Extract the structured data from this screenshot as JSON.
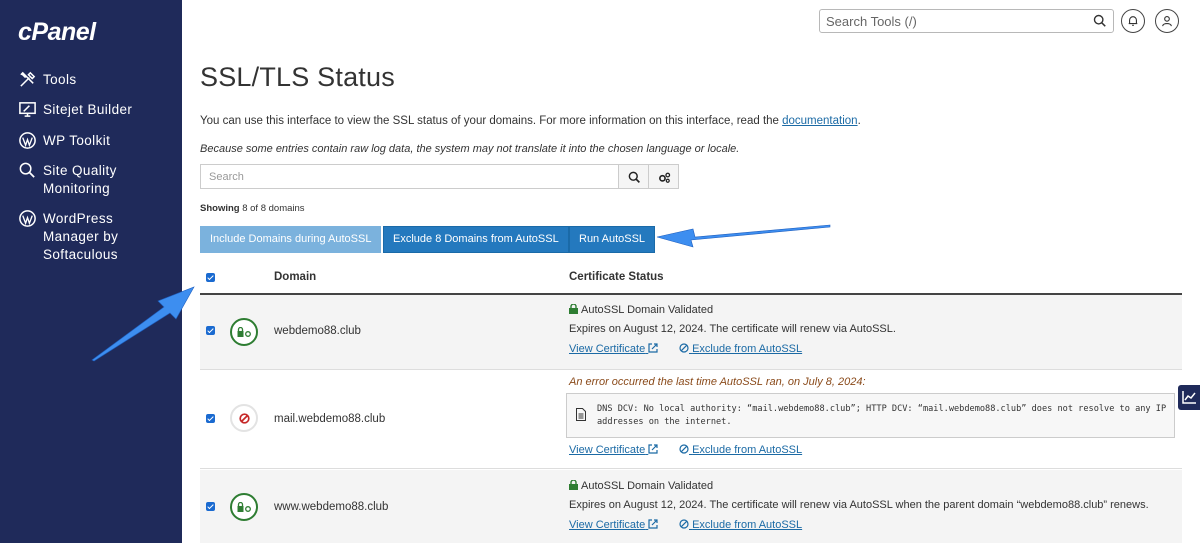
{
  "app": {
    "logo": "cPanel"
  },
  "sidebar": {
    "items": [
      {
        "label": "Tools",
        "icon": "tools-icon"
      },
      {
        "label": "Sitejet Builder",
        "icon": "monitor-icon"
      },
      {
        "label": "WP Toolkit",
        "icon": "wordpress-icon"
      },
      {
        "label": "Site Quality Monitoring",
        "icon": "magnifier-icon"
      },
      {
        "label": "WordPress Manager by Softaculous",
        "icon": "wordpress-icon"
      }
    ]
  },
  "topbar": {
    "search_placeholder": "Search Tools (/)"
  },
  "page": {
    "title": "SSL/TLS Status",
    "intro_text": "You can use this interface to view the SSL status of your domains. For more information on this interface, read the ",
    "intro_link": "documentation",
    "intro_end": ".",
    "note": "Because some entries contain raw log data, the system may not translate it into the chosen language or locale.",
    "filter_placeholder": "Search",
    "showing_label": "Showing",
    "showing_text": "8 of 8 domains"
  },
  "actions": {
    "include": "Include Domains during AutoSSL",
    "exclude": "Exclude 8 Domains from AutoSSL",
    "run": "Run AutoSSL"
  },
  "table": {
    "headers": {
      "domain": "Domain",
      "status": "Certificate Status"
    },
    "rows": [
      {
        "domain": "webdemo88.club",
        "state": "valid",
        "status_title": "AutoSSL Domain Validated",
        "expires": "Expires on August 12, 2024. The certificate will renew via AutoSSL.",
        "view_label": "View Certificate",
        "exclude_label": "Exclude from AutoSSL"
      },
      {
        "domain": "mail.webdemo88.club",
        "state": "error",
        "error_title": "An error occurred the last time AutoSSL ran, on July 8, 2024:",
        "error_message": "DNS DCV: No local authority: “mail.webdemo88.club”; HTTP DCV: “mail.webdemo88.club” does not resolve to any IP addresses on the internet.",
        "view_label": "View Certificate",
        "exclude_label": "Exclude from AutoSSL"
      },
      {
        "domain": "www.webdemo88.club",
        "state": "valid",
        "status_title": "AutoSSL Domain Validated",
        "expires": "Expires on August 12, 2024. The certificate will renew via AutoSSL when the parent domain “webdemo88.club” renews.",
        "view_label": "View Certificate",
        "exclude_label": "Exclude from AutoSSL"
      }
    ]
  },
  "colors": {
    "sidebar_bg": "#1f2a5a",
    "primary_button": "#2479be",
    "disabled_button": "#7bb2dd",
    "valid_green": "#2e7d32",
    "error_red": "#c62828",
    "link": "#1b6aa5",
    "annotation_arrow": "#3d8ef0"
  }
}
